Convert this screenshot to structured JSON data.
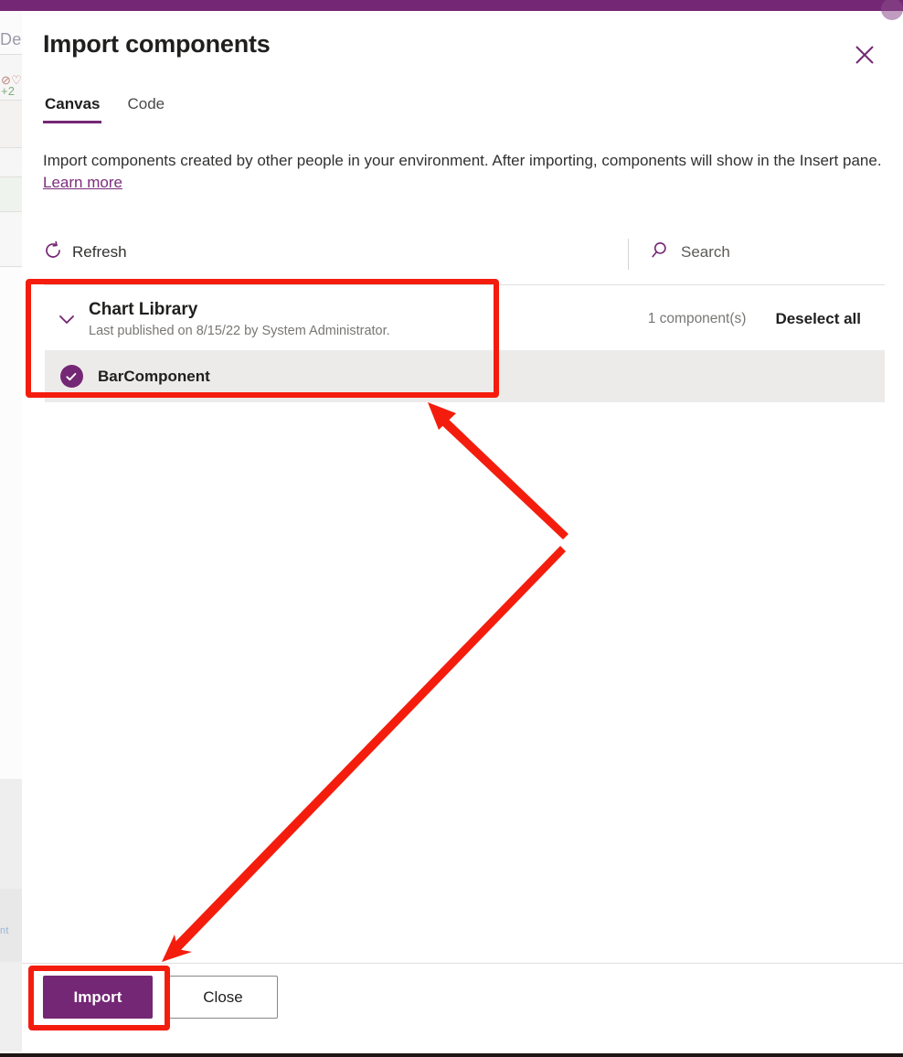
{
  "background": {
    "fragments": [
      {
        "text": "Den"
      },
      {
        "text": "⊘♡"
      },
      {
        "text": "+2"
      },
      {
        "text": "nt"
      }
    ]
  },
  "dialog": {
    "title": "Import components",
    "close_icon": "close-icon",
    "tabs": [
      {
        "label": "Canvas",
        "active": true
      },
      {
        "label": "Code",
        "active": false
      }
    ],
    "description": {
      "text": "Import components created by other people in your environment. After importing, components will show in the Insert pane. ",
      "link_label": "Learn more"
    },
    "commandbar": {
      "refresh_icon": "refresh-icon",
      "refresh_label": "Refresh",
      "search_icon": "search-icon",
      "search_placeholder": "Search"
    },
    "library": {
      "chevron_icon": "chevron-down-icon",
      "name": "Chart Library",
      "subtitle": "Last published on 8/15/22 by System Administrator.",
      "count_label": "1 component(s)",
      "deselect_all_label": "Deselect all",
      "components": [
        {
          "name": "BarComponent",
          "selected": true,
          "check_icon": "check-circle-icon"
        }
      ]
    },
    "footer": {
      "primary_label": "Import",
      "secondary_label": "Close"
    }
  },
  "colors": {
    "brand_purple": "#742774",
    "selected_row": "#edebe9",
    "annotation_red": "#f41d0d",
    "link_purple": "#7c2d7c",
    "divider": "#e1dfdd"
  },
  "annotations": {
    "boxes": [
      {
        "name": "chart-library-highlight"
      },
      {
        "name": "import-button-highlight"
      }
    ],
    "arrows": [
      {
        "name": "arrow-to-chart-library"
      },
      {
        "name": "arrow-to-import-button"
      }
    ]
  }
}
